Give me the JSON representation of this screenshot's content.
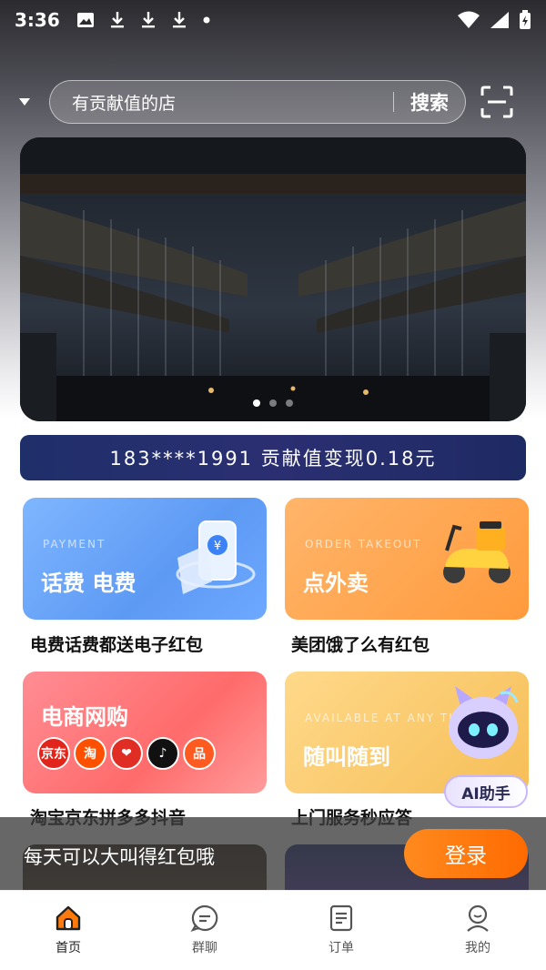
{
  "status_bar": {
    "time": "3:36"
  },
  "search": {
    "placeholder": "有贡献值的店",
    "button_label": "搜索"
  },
  "banner": {
    "dot_count": 3,
    "active_index": 0
  },
  "contribution": {
    "text": "183****1991 贡献值变现0.18元"
  },
  "cards": {
    "pay": {
      "subtitle": "PAYMENT",
      "title": "话费 电费",
      "caption": "电费话费都送电子红包"
    },
    "food": {
      "subtitle": "ORDER TAKEOUT",
      "title": "点外卖",
      "caption": "美团饿了么有红包"
    },
    "shop": {
      "title": "电商网购",
      "caption": "淘宝京东拼多多抖音",
      "logos": [
        {
          "label": "京东",
          "color": "#e1251b"
        },
        {
          "label": "淘",
          "color": "#ff5000"
        },
        {
          "label": "❤",
          "color": "#e02e24"
        },
        {
          "label": "♪",
          "color": "#111111"
        },
        {
          "label": "品",
          "color": "#ff5a1f"
        }
      ]
    },
    "service": {
      "subtitle": "AVAILABLE AT ANY TI",
      "title": "随叫随到",
      "caption": "上门服务秒应答"
    }
  },
  "ai_badge": {
    "label": "AI助手"
  },
  "login_banner": {
    "text": "每天可以大叫得红包哦",
    "button_label": "登录"
  },
  "bottom_nav": [
    {
      "label": "首页",
      "icon": "home-icon",
      "active": true
    },
    {
      "label": "群聊",
      "icon": "chat-icon",
      "active": false
    },
    {
      "label": "订单",
      "icon": "order-icon",
      "active": false
    },
    {
      "label": "我的",
      "icon": "profile-icon",
      "active": false
    }
  ],
  "colors": {
    "accent": "#ff7a0c",
    "contrib_bg": "#25307a"
  }
}
